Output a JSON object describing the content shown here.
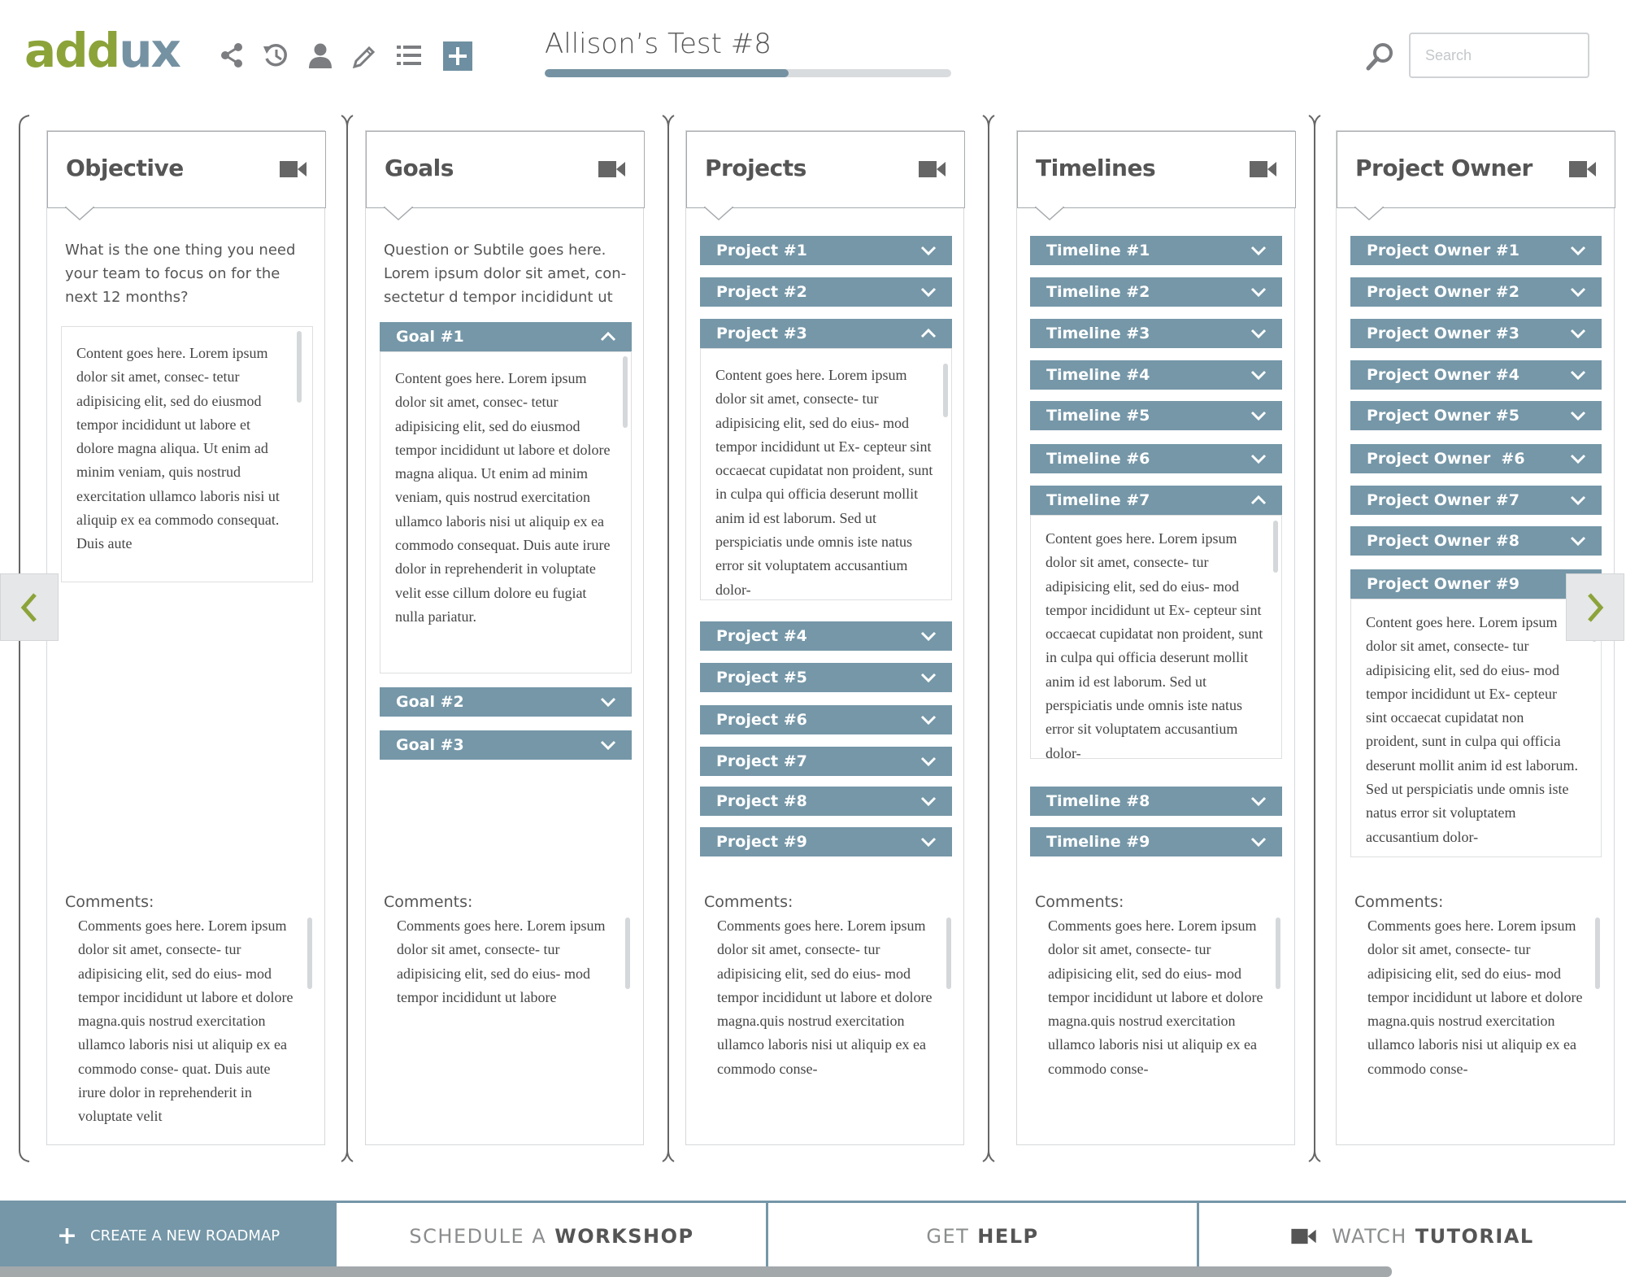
{
  "brand": {
    "part1": "add",
    "part2": "ux"
  },
  "toolbar": {
    "icons": [
      "share-icon",
      "history-icon",
      "user-icon",
      "pencil-icon",
      "list-icon",
      "plus-icon"
    ]
  },
  "document": {
    "title": "Allison’s Test #8",
    "progress_percent": 60
  },
  "search": {
    "placeholder": "Search",
    "value": ""
  },
  "columns": {
    "objective": {
      "title": "Objective",
      "intro": "What is the one thing you need your team to focus on for the next 12 months?",
      "content": "Content goes here.  Lorem ipsum dolor sit amet, consec- tetur adipisicing elit, sed do eiusmod tempor incididunt ut labore et dolore magna aliqua. Ut enim ad minim veniam, quis nostrud exercitation ullamco laboris nisi ut aliquip ex ea commodo consequat. Duis aute",
      "comments_label": "Comments:",
      "comments": "Comments goes here.  Lorem ipsum dolor sit amet, consecte- tur adipisicing elit, sed do eius- mod tempor incididunt ut labore et dolore magna.quis nostrud exercitation ullamco laboris nisi ut aliquip ex ea commodo conse- quat. Duis aute irure dolor in reprehenderit in voluptate velit"
    },
    "goals": {
      "title": "Goals",
      "intro": "Question or Subtile goes here. Lorem ipsum dolor sit amet, con- sectetur d tempor incididunt ut",
      "items": [
        "Goal #1",
        "Goal #2",
        "Goal #3"
      ],
      "content": "Content goes here.  Lorem ipsum dolor sit amet, consec- tetur adipisicing elit, sed do eiusmod tempor incididunt ut labore et dolore magna aliqua. Ut enim ad minim veniam, quis nostrud exercitation ullamco laboris nisi ut aliquip ex ea commodo consequat. Duis aute irure dolor in reprehenderit in voluptate velit esse cillum dolore eu fugiat nulla pariatur.",
      "comments_label": "Comments:",
      "comments": "Comments goes here.  Lorem ipsum dolor sit amet, consecte- tur adipisicing elit, sed do eius- mod tempor incididunt ut labore"
    },
    "projects": {
      "title": "Projects",
      "items": [
        "Project #1",
        "Project #2",
        "Project #3",
        "Project #4",
        "Project #5",
        "Project #6",
        "Project #7",
        "Project #8",
        "Project #9"
      ],
      "content": "Content goes here.  Lorem ipsum dolor sit amet, consecte- tur adipisicing elit, sed do eius- mod tempor incididunt ut Ex- cepteur sint occaecat cupidatat non proident, sunt in culpa qui officia deserunt mollit anim id est laborum. Sed ut perspiciatis unde omnis iste natus error sit voluptatem accusantium dolor-",
      "comments_label": "Comments:",
      "comments": "Comments goes here.  Lorem ipsum dolor sit amet, consecte- tur adipisicing elit, sed do eius- mod tempor incididunt ut labore et dolore magna.quis nostrud exercitation ullamco laboris nisi ut aliquip ex ea commodo conse-"
    },
    "timelines": {
      "title": "Timelines",
      "items": [
        "Timeline #1",
        "Timeline #2",
        "Timeline #3",
        "Timeline #4",
        "Timeline #5",
        "Timeline #6",
        "Timeline #7",
        "Timeline #8",
        "Timeline #9"
      ],
      "content": "Content goes here.  Lorem ipsum dolor sit amet, consecte- tur adipisicing elit, sed do eius- mod tempor incididunt ut Ex- cepteur sint occaecat cupidatat non proident, sunt in culpa qui officia deserunt mollit anim id est laborum. Sed ut perspiciatis unde omnis iste natus error sit voluptatem accusantium dolor-",
      "comments_label": "Comments:",
      "comments": "Comments goes here.  Lorem ipsum dolor sit amet, consecte- tur adipisicing elit, sed do eius- mod tempor incididunt ut labore et dolore magna.quis nostrud exercitation ullamco laboris nisi ut aliquip ex ea commodo conse-"
    },
    "owners": {
      "title": "Project Owner",
      "items": [
        "Project Owner #1",
        "Project Owner #2",
        "Project Owner #3",
        "Project Owner #4",
        "Project Owner #5",
        "Project Owner  #6",
        "Project Owner #7",
        "Project Owner #8",
        "Project Owner #9"
      ],
      "content": "Content goes here.  Lorem ipsum dolor sit amet, consecte- tur adipisicing elit, sed do eius- mod tempor incididunt ut Ex- cepteur sint occaecat cupidatat non proident, sunt in culpa qui officia deserunt mollit anim id est laborum. Sed ut perspiciatis unde omnis iste natus error sit voluptatem accusantium dolor-",
      "comments_label": "Comments:",
      "comments": "Comments goes here.  Lorem ipsum dolor sit amet, consecte- tur adipisicing elit, sed do eius- mod tempor incididunt ut labore et dolore magna.quis nostrud exercitation ullamco laboris nisi ut aliquip ex ea commodo conse-"
    }
  },
  "bottom": {
    "create": "CREATE A NEW ROADMAP",
    "workshop_a": "SCHEDULE A",
    "workshop_b": "WORKSHOP",
    "help_a": "GET",
    "help_b": "HELP",
    "tutorial_a": "WATCH",
    "tutorial_b": "TUTORIAL"
  },
  "colors": {
    "accent": "#7597a8",
    "brand_green": "#8ca33a",
    "brand_blue": "#7592a3",
    "text": "#555555"
  }
}
